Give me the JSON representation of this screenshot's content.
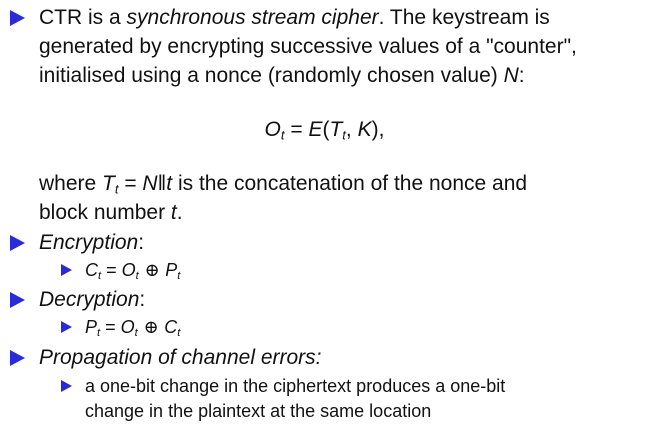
{
  "bullets": {
    "ctr": {
      "line1_pre": "CTR is a ",
      "line1_em": "synchronous stream cipher",
      "line1_post": ". The keystream is",
      "line2": "generated by encrypting successive values of a \"counter\",",
      "line3_pre": "initialised using a nonce (randomly chosen value) ",
      "line3_var": "N",
      "line3_post": ":",
      "eq_O": "O",
      "eq_sub_t": "t",
      "eq_equals": " = ",
      "eq_E": "E",
      "eq_open": "(",
      "eq_T": "T",
      "eq_comma": ", ",
      "eq_K": "K",
      "eq_close": "),",
      "where_pre": "where ",
      "where_T": "T",
      "where_sub": "t",
      "where_eq": " = ",
      "where_N": "N",
      "where_concat": "‖",
      "where_t": "t",
      "where_post": " is the concatenation of the nonce and",
      "block_pre": "block number ",
      "block_t": "t",
      "block_post": "."
    },
    "encryption": {
      "label": "Encryption",
      "colon": ":",
      "formula": {
        "lhs": "C",
        "sub1": "t",
        "eq": " = ",
        "o": "O",
        "sub2": "t",
        "op": " ⊕ ",
        "rhs": "P",
        "sub3": "t"
      }
    },
    "decryption": {
      "label": "Decryption",
      "colon": ":",
      "formula": {
        "lhs": "P",
        "sub1": "t",
        "eq": " = ",
        "o": "O",
        "sub2": "t",
        "op": " ⊕ ",
        "rhs": "C",
        "sub3": "t"
      }
    },
    "propagation": {
      "label": "Propagation of channel errors:",
      "sub_line1": "a one-bit change in the ciphertext produces a one-bit",
      "sub_line2": "change in the plaintext at the same location"
    }
  },
  "colors": {
    "bullet": "#2a2ad8",
    "text": "#111111"
  }
}
